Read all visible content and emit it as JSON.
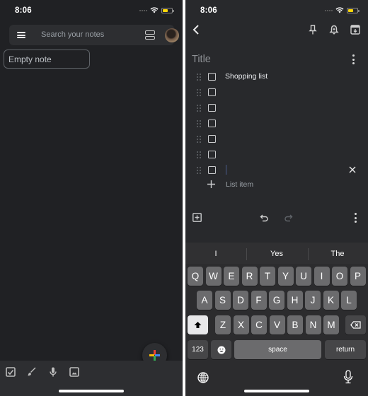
{
  "left_screen": {
    "status_bar": {
      "time": "8:06"
    },
    "search_bar": {
      "menu_icon": "hamburger-icon",
      "placeholder": "Search your notes",
      "view_toggle_icon": "list-view-icon",
      "avatar": "account-avatar"
    },
    "notes": [
      {
        "label": "Empty note"
      }
    ],
    "fab": {
      "icon": "multicolor-plus-icon",
      "colors": [
        "#ea4335",
        "#4285f4",
        "#34a853",
        "#fbbc05"
      ]
    },
    "bottom_bar": {
      "icons": [
        "new-list-checkbox-icon",
        "drawing-brush-icon",
        "voice-note-mic-icon",
        "image-note-icon"
      ]
    }
  },
  "right_screen": {
    "status_bar": {
      "time": "8:06"
    },
    "top_bar": {
      "back_icon": "back-chevron-icon",
      "actions": [
        "pin-icon",
        "reminder-bell-icon",
        "archive-icon"
      ]
    },
    "title_placeholder": "Title",
    "list_items": [
      {
        "text": "Shopping list",
        "checked": false
      },
      {
        "text": "",
        "checked": false
      },
      {
        "text": "",
        "checked": false
      },
      {
        "text": "",
        "checked": false
      },
      {
        "text": "",
        "checked": false
      },
      {
        "text": "",
        "checked": false
      },
      {
        "text": "",
        "checked": false,
        "focused": true
      }
    ],
    "add_item_label": "List item",
    "editor_toolbar": {
      "icons": [
        "add-box-icon",
        "undo-icon",
        "redo-icon",
        "more-vert-icon"
      ]
    },
    "keyboard": {
      "suggestions": [
        "I",
        "Yes",
        "The"
      ],
      "row1": [
        "Q",
        "W",
        "E",
        "R",
        "T",
        "Y",
        "U",
        "I",
        "O",
        "P"
      ],
      "row2": [
        "A",
        "S",
        "D",
        "F",
        "G",
        "H",
        "J",
        "K",
        "L"
      ],
      "row3": [
        "Z",
        "X",
        "C",
        "V",
        "B",
        "N",
        "M"
      ],
      "numbers_key": "123",
      "space_key": "space",
      "return_key": "return"
    }
  },
  "colors": {
    "left_bg": "#202124",
    "right_bg": "#28292c",
    "battery": "#ffd60a"
  }
}
